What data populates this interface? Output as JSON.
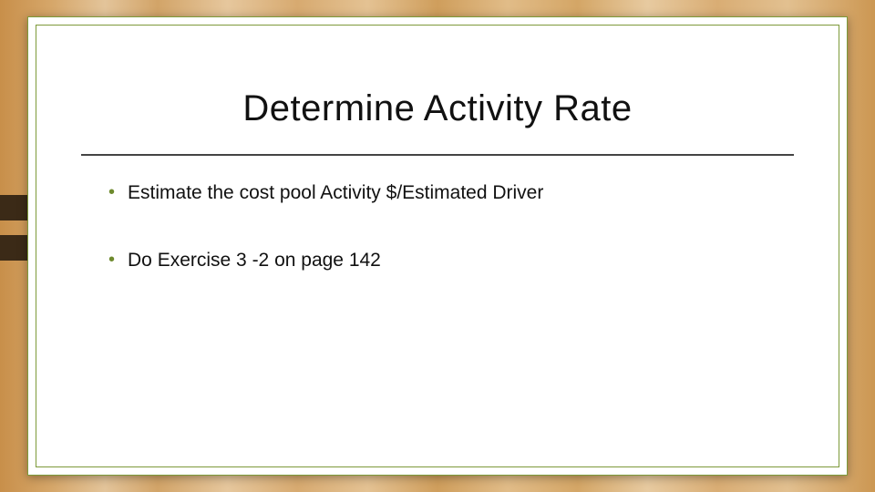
{
  "slide": {
    "title": "Determine Activity Rate",
    "bullets": [
      "Estimate the cost pool Activity $/Estimated Driver",
      "Do Exercise 3 -2 on page 142"
    ]
  },
  "theme": {
    "accent": "#7d9a3a",
    "bullet_color": "#6e8a2e"
  }
}
